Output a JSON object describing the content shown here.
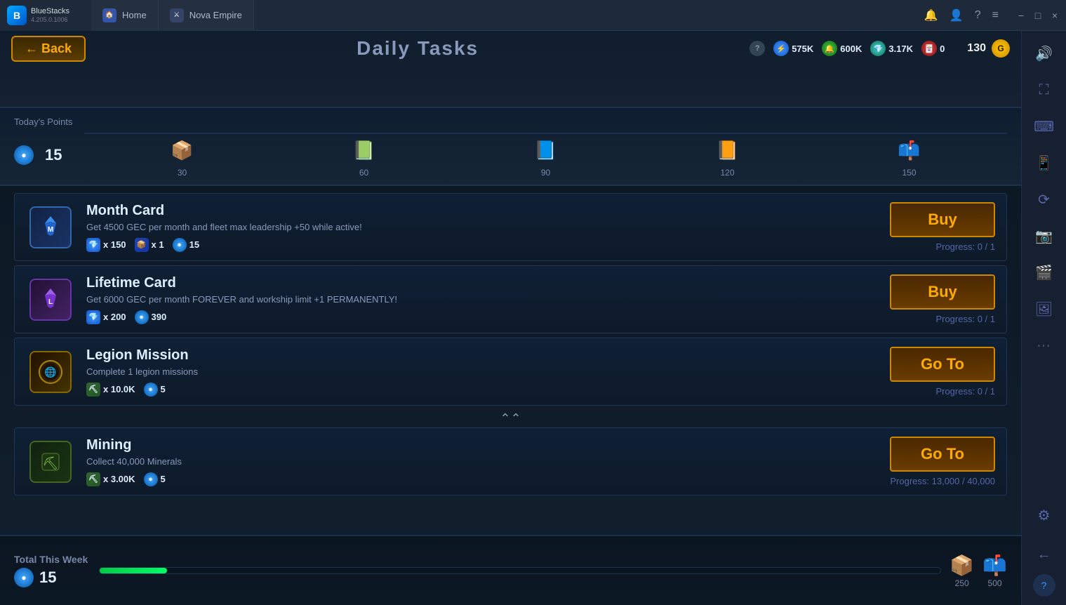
{
  "titleBar": {
    "appName": "BlueStacks",
    "version": "4.205.0.1006",
    "tabs": [
      {
        "label": "Home",
        "icon": "🏠"
      },
      {
        "label": "Nova Empire",
        "icon": "⚔"
      }
    ],
    "windowControls": [
      "−",
      "□",
      "×"
    ]
  },
  "header": {
    "backLabel": "← Back",
    "title": "Daily Tasks",
    "resources": [
      {
        "icon": "?",
        "type": "question"
      },
      {
        "value": "575K",
        "color": "blue",
        "icon": "⚡"
      },
      {
        "value": "600K",
        "color": "green",
        "icon": "🔔"
      },
      {
        "value": "3.17K",
        "color": "teal",
        "icon": "💎"
      },
      {
        "value": "0",
        "color": "red",
        "icon": "🃏"
      }
    ],
    "currency": "130"
  },
  "todaysPoints": {
    "label": "Today's Points",
    "value": "15",
    "progressPercent": 12,
    "milestones": [
      {
        "value": "30",
        "emoji": "📦"
      },
      {
        "value": "60",
        "emoji": "📗"
      },
      {
        "value": "90",
        "emoji": "📘"
      },
      {
        "value": "120",
        "emoji": "📙"
      },
      {
        "value": "150",
        "emoji": "📫"
      }
    ]
  },
  "tasks": [
    {
      "id": "month-card",
      "name": "Month Card",
      "desc": "Get 4500 GEC per month and fleet max leadership +50 while active!",
      "icon": "M",
      "iconType": "month-card",
      "rewards": [
        {
          "icon": "💎",
          "type": "blue",
          "value": "x 150"
        },
        {
          "icon": "📦",
          "type": "chest",
          "value": "x 1"
        },
        {
          "icon": "🔵",
          "type": "orb",
          "value": "15"
        }
      ],
      "actionLabel": "Buy",
      "progress": "Progress: 0 / 1"
    },
    {
      "id": "lifetime-card",
      "name": "Lifetime Card",
      "desc": "Get 6000 GEC per month FOREVER and workship limit +1 PERMANENTLY!",
      "icon": "L",
      "iconType": "lifetime-card",
      "rewards": [
        {
          "icon": "💎",
          "type": "blue",
          "value": "x 200"
        },
        {
          "icon": "🔵",
          "type": "orb",
          "value": "390"
        }
      ],
      "actionLabel": "Buy",
      "progress": "Progress: 0 / 1"
    },
    {
      "id": "legion-mission",
      "name": "Legion Mission",
      "desc": "Complete 1 legion missions",
      "icon": "🌐",
      "iconType": "legion",
      "rewards": [
        {
          "icon": "⛏",
          "type": "mineral",
          "value": "x 10.0K"
        },
        {
          "icon": "🔵",
          "type": "orb",
          "value": "5"
        }
      ],
      "actionLabel": "Go To",
      "progress": "Progress: 0 / 1"
    },
    {
      "id": "mining",
      "name": "Mining",
      "desc": "Collect 40,000 Minerals",
      "icon": "⛏",
      "iconType": "mining",
      "rewards": [
        {
          "icon": "⛏",
          "type": "mineral",
          "value": "x 3.00K"
        },
        {
          "icon": "🔵",
          "type": "orb",
          "value": "5"
        }
      ],
      "actionLabel": "Go To",
      "progress": "Progress: 13,000 / 40,000"
    }
  ],
  "weeklySection": {
    "label": "Total This Week",
    "value": "15",
    "progressPercent": 8,
    "milestones": [
      {
        "value": "250",
        "emoji": "📦"
      },
      {
        "value": "500",
        "emoji": "📫"
      }
    ]
  },
  "sidebar": {
    "icons": [
      {
        "name": "bell-icon",
        "symbol": "🔔"
      },
      {
        "name": "user-icon",
        "symbol": "👤"
      },
      {
        "name": "help-icon",
        "symbol": "?"
      },
      {
        "name": "menu-icon",
        "symbol": "≡"
      },
      {
        "name": "minimize-icon",
        "symbol": "−"
      },
      {
        "name": "restore-icon",
        "symbol": "□"
      },
      {
        "name": "close-icon",
        "symbol": "×"
      },
      {
        "name": "volume-icon",
        "symbol": "🔊"
      },
      {
        "name": "fullscreen-icon",
        "symbol": "⛶"
      },
      {
        "name": "keyboard-icon",
        "symbol": "⌨"
      },
      {
        "name": "phone-icon",
        "symbol": "📱"
      },
      {
        "name": "rotate-icon",
        "symbol": "⟳"
      },
      {
        "name": "screenshot-icon",
        "symbol": "📷"
      },
      {
        "name": "video-icon",
        "symbol": "🎬"
      },
      {
        "name": "gallery-icon",
        "symbol": "🖼"
      },
      {
        "name": "more-icon",
        "symbol": "⋯"
      },
      {
        "name": "gear-icon",
        "symbol": "⚙"
      },
      {
        "name": "back-icon",
        "symbol": "←"
      }
    ]
  }
}
